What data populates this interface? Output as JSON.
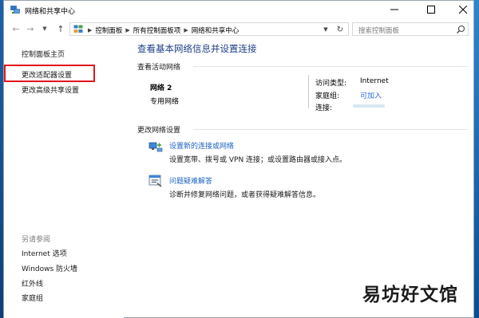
{
  "window": {
    "title": "网络和共享中心",
    "app_icon": "network-sharing-icon"
  },
  "titlebar_buttons": {
    "minimize_icon": "minimize-icon",
    "maximize_icon": "maximize-icon",
    "close_icon": "close-icon"
  },
  "address": {
    "breadcrumbs": [
      "控制面板",
      "所有控制面板项",
      "网络和共享中心"
    ],
    "search_placeholder": "搜索控制面板"
  },
  "sidebar": {
    "home": "控制面板主页",
    "items": [
      "更改适配器设置",
      "更改高级共享设置"
    ],
    "see_also_label": "另请参阅",
    "see_also": [
      "Internet 选项",
      "Windows 防火墙",
      "红外线",
      "家庭组"
    ]
  },
  "main": {
    "title": "查看基本网络信息并设置连接",
    "active_networks_label": "查看活动网络",
    "network": {
      "name": "网络  2",
      "type": "专用网络",
      "access_label": "访问类型:",
      "access_value": "Internet",
      "homegroup_label": "家庭组:",
      "homegroup_value": "可加入",
      "connection_label": "连接:"
    },
    "change_settings_label": "更改网络设置",
    "tasks": [
      {
        "icon": "new-connection-icon",
        "link": "设置新的连接或网络",
        "desc": "设置宽带、拨号或 VPN 连接；或设置路由器或接入点。"
      },
      {
        "icon": "troubleshoot-icon",
        "link": "问题疑难解答",
        "desc": "诊断并修复网络问题，或者获得疑难解答信息。"
      }
    ]
  },
  "annotation": {
    "highlight_color": "#e3151a"
  },
  "watermark": "易坊好文馆",
  "colors": {
    "title_blue": "#1e3f86",
    "link_blue": "#1e63c0"
  }
}
